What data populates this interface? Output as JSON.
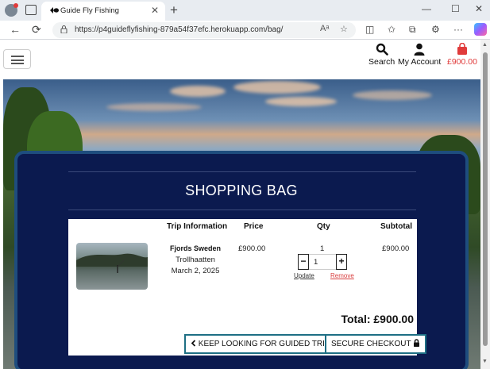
{
  "browser": {
    "tab_title": "Guide Fly Fishing",
    "tab_favicon": "fish-icon",
    "url": "https://p4guideflyfishing-879a54f37efc.herokuapp.com/bag/"
  },
  "header": {
    "search_label": "Search",
    "account_label": "My Account",
    "bag_total": "£900.00",
    "bag_color": "#e03b3b"
  },
  "bag": {
    "title": "SHOPPING BAG",
    "columns": [
      "Trip Information",
      "Price",
      "Qty",
      "Subtotal"
    ],
    "item": {
      "name": "Fjords Sweden",
      "location": "Trollhaatten",
      "date": "March 2, 2025",
      "price": "£900.00",
      "qty_display": "1",
      "qty_value": "1",
      "update_label": "Update",
      "remove_label": "Remove",
      "subtotal": "£900.00"
    },
    "total": "Total: £900.00",
    "keep_looking_label": "KEEP LOOKING FOR GUIDED TRIPS",
    "checkout_label": "SECURE CHECKOUT"
  },
  "colors": {
    "panel_bg": "#0b1a4f",
    "panel_border": "#1e4d7e",
    "button_border": "#1e6f84",
    "remove_link": "#d94040"
  }
}
